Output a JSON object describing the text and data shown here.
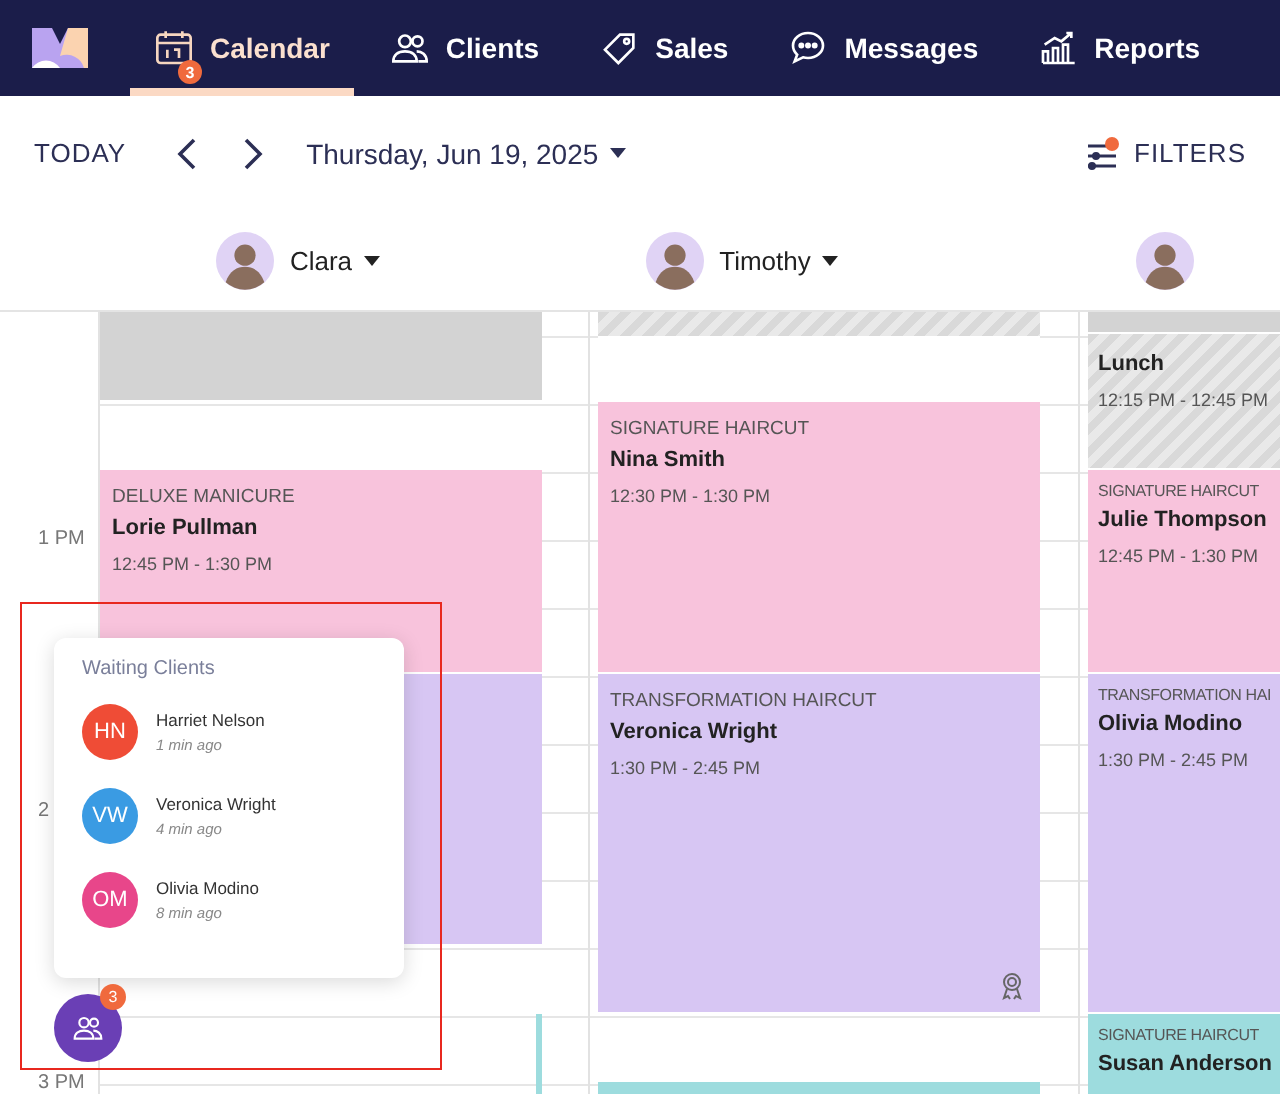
{
  "nav": {
    "tabs": [
      {
        "label": "Calendar",
        "selected": true,
        "badge": "3"
      },
      {
        "label": "Clients",
        "selected": false
      },
      {
        "label": "Sales",
        "selected": false
      },
      {
        "label": "Messages",
        "selected": false
      },
      {
        "label": "Reports",
        "selected": false
      }
    ]
  },
  "toolbar": {
    "today": "TODAY",
    "date": "Thursday, Jun 19, 2025",
    "filters": "FILTERS",
    "filters_active": true
  },
  "staff": [
    {
      "kind": "named",
      "name": "Clara"
    },
    {
      "kind": "named",
      "name": "Timothy"
    },
    {
      "kind": "avatar"
    }
  ],
  "time_labels": [
    "1 PM",
    "2",
    "3 PM"
  ],
  "columns": [
    {
      "events": [
        {
          "kind": "blocked"
        },
        {
          "kind": "appointment",
          "service": "DELUXE MANICURE",
          "client": "Lorie Pullman",
          "time": "12:45 PM - 1:30 PM",
          "color": "#f8c3dc"
        },
        {
          "kind": "appointment",
          "color": "#d7c6f3"
        },
        {
          "kind": "strip",
          "color": "#9ddcde"
        }
      ]
    },
    {
      "events": [
        {
          "kind": "break"
        },
        {
          "kind": "appointment",
          "service": "SIGNATURE HAIRCUT",
          "client": "Nina Smith",
          "time": "12:30 PM - 1:30 PM",
          "color": "#f8c3dc"
        },
        {
          "kind": "appointment",
          "service": "TRANSFORMATION HAIRCUT",
          "client": "Veronica Wright",
          "time": "1:30 PM - 2:45 PM",
          "color": "#d7c6f3",
          "reward": true
        },
        {
          "kind": "appointment",
          "color": "#9ddcde"
        }
      ]
    },
    {
      "events": [
        {
          "kind": "blocked"
        },
        {
          "kind": "break",
          "client": "Lunch",
          "time": "12:15 PM - 12:45 PM"
        },
        {
          "kind": "appointment",
          "service": "SIGNATURE HAIRCUT",
          "client": "Julie Thompson",
          "time": "12:45 PM - 1:30 PM",
          "color": "#f8c3dc"
        },
        {
          "kind": "appointment",
          "service": "TRANSFORMATION HAI",
          "client": "Olivia Modino",
          "time": "1:30 PM - 2:45 PM",
          "color": "#d7c6f3"
        },
        {
          "kind": "appointment",
          "service": "SIGNATURE HAIRCUT",
          "client": "Susan Anderson",
          "color": "#9ddcde"
        }
      ]
    }
  ],
  "waiting": {
    "title": "Waiting Clients",
    "count": "3",
    "clients": [
      {
        "initials": "HN",
        "name": "Harriet Nelson",
        "waited": "1 min ago",
        "color": "#ef4c36"
      },
      {
        "initials": "VW",
        "name": "Veronica Wright",
        "waited": "4 min ago",
        "color": "#3a9be3"
      },
      {
        "initials": "OM",
        "name": "Olivia Modino",
        "waited": "8 min ago",
        "color": "#e8468a"
      }
    ]
  }
}
